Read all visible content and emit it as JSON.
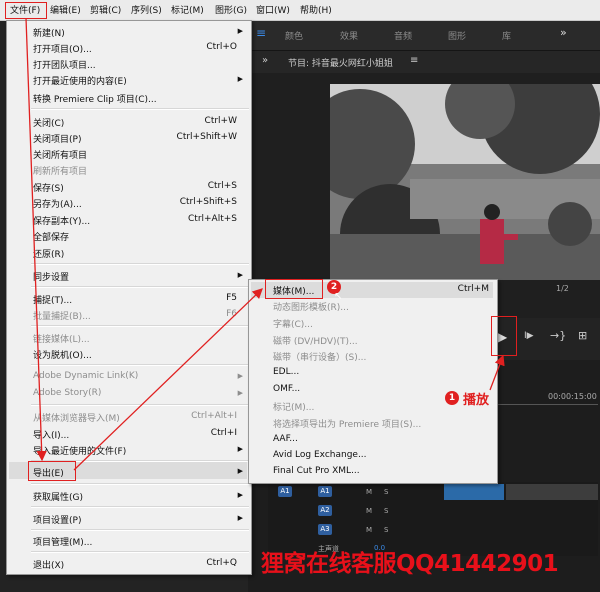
{
  "menubar": [
    "文件(F)",
    "编辑(E)",
    "剪辑(C)",
    "序列(S)",
    "标记(M)",
    "图形(G)",
    "窗口(W)",
    "帮助(H)"
  ],
  "panel_tabs": [
    "颜色",
    "效果",
    "音频",
    "图形",
    "库"
  ],
  "monitor": {
    "title": "节目: 抖音最火网红小姐姐",
    "page": "1/2",
    "timecode": "00:00:15:00"
  },
  "file_menu": {
    "new": "新建(N)",
    "open_project": "打开项目(O)...",
    "open_project_sc": "Ctrl+O",
    "open_team": "打开团队项目...",
    "open_recent": "打开最近使用的内容(E)",
    "convert_clip": "转换 Premiere Clip 项目(C)...",
    "close": "关闭(C)",
    "close_sc": "Ctrl+W",
    "close_project": "关闭项目(P)",
    "close_project_sc": "Ctrl+Shift+W",
    "close_all": "关闭所有项目",
    "refresh_all": "刷新所有项目",
    "save": "保存(S)",
    "save_sc": "Ctrl+S",
    "save_as": "另存为(A)...",
    "save_as_sc": "Ctrl+Shift+S",
    "save_copy": "保存副本(Y)...",
    "save_copy_sc": "Ctrl+Alt+S",
    "save_all": "全部保存",
    "revert": "还原(R)",
    "sync": "同步设置",
    "capture": "捕捉(T)...",
    "capture_sc": "F5",
    "batch_capture": "批量捕捉(B)...",
    "batch_capture_sc": "F6",
    "link_media": "链接媒体(L)...",
    "make_offline": "设为脱机(O)...",
    "dynamic_link": "Adobe Dynamic Link(K)",
    "adobe_story": "Adobe Story(R)",
    "import_browser": "从媒体浏览器导入(M)",
    "import_browser_sc": "Ctrl+Alt+I",
    "import": "导入(I)...",
    "import_sc": "Ctrl+I",
    "import_recent": "导入最近使用的文件(F)",
    "export": "导出(E)",
    "get_properties": "获取属性(G)",
    "project_settings": "项目设置(P)",
    "project_manager": "项目管理(M)...",
    "exit": "退出(X)",
    "exit_sc": "Ctrl+Q"
  },
  "export_menu": {
    "media": "媒体(M)...",
    "media_sc": "Ctrl+M",
    "motion_graphics": "动态图形模板(R)...",
    "captions": "字幕(C)...",
    "tape_dv": "磁带 (DV/HDV)(T)...",
    "tape_serial": "磁带（串行设备）(S)...",
    "edl": "EDL...",
    "omf": "OMF...",
    "markers": "标记(M)...",
    "selection_premiere": "将选择项导出为 Premiere 项目(S)...",
    "aaf": "AAF...",
    "avid": "Avid Log Exchange...",
    "fcp": "Final Cut Pro XML..."
  },
  "annotations": {
    "badge1": "1",
    "badge2": "2",
    "play_label": "播放"
  },
  "timeline": {
    "tracks": [
      "A1",
      "A2",
      "A3"
    ],
    "track_btns": [
      "M",
      "S"
    ],
    "master": "主声道",
    "master_val": "0.0"
  },
  "watermark": "狸窝在线客服QQ41442901",
  "colors": {
    "accent_red": "#e02020",
    "watermark_red": "#e8101a"
  }
}
